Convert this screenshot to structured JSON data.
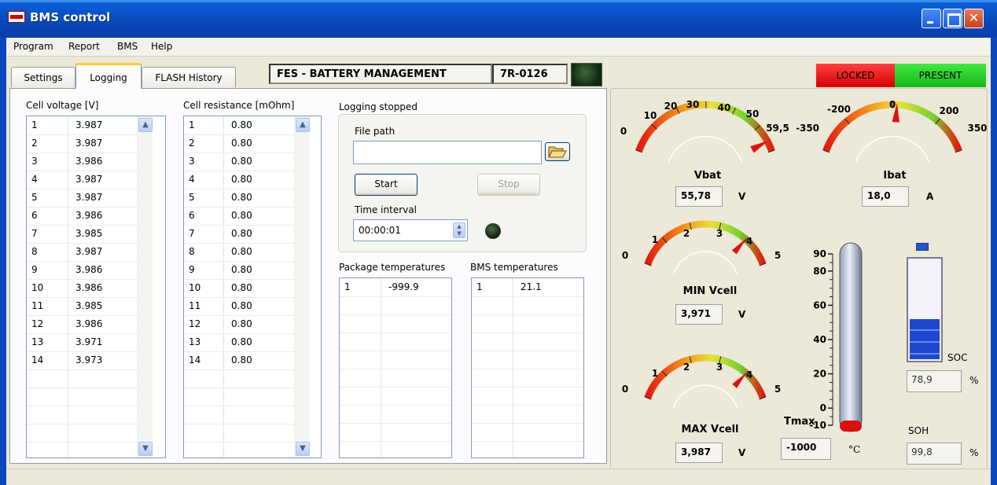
{
  "window": {
    "title": "BMS control"
  },
  "menu": [
    "Program",
    "Report",
    "BMS",
    "Help"
  ],
  "tabs": [
    "Settings",
    "Logging",
    "FLASH History"
  ],
  "header": {
    "device_name": "FES - BATTERY MANAGEMENT",
    "device_id": "7R-0126"
  },
  "status": {
    "locked": "LOCKED",
    "present": "PRESENT",
    "locked_color": "#e81c1c",
    "present_color": "#2ad12a"
  },
  "cell_voltage": {
    "label": "Cell voltage [V]",
    "rows": [
      [
        "1",
        "3.987"
      ],
      [
        "2",
        "3.987"
      ],
      [
        "3",
        "3.986"
      ],
      [
        "4",
        "3.987"
      ],
      [
        "5",
        "3.987"
      ],
      [
        "6",
        "3.986"
      ],
      [
        "7",
        "3.985"
      ],
      [
        "8",
        "3.987"
      ],
      [
        "9",
        "3.986"
      ],
      [
        "10",
        "3.986"
      ],
      [
        "11",
        "3.985"
      ],
      [
        "12",
        "3.986"
      ],
      [
        "13",
        "3.971"
      ],
      [
        "14",
        "3.973"
      ]
    ]
  },
  "cell_resistance": {
    "label": "Cell resistance [mOhm]",
    "rows": [
      [
        "1",
        "0.80"
      ],
      [
        "2",
        "0.80"
      ],
      [
        "3",
        "0.80"
      ],
      [
        "4",
        "0.80"
      ],
      [
        "5",
        "0.80"
      ],
      [
        "6",
        "0.80"
      ],
      [
        "7",
        "0.80"
      ],
      [
        "8",
        "0.80"
      ],
      [
        "9",
        "0.80"
      ],
      [
        "10",
        "0.80"
      ],
      [
        "11",
        "0.80"
      ],
      [
        "12",
        "0.80"
      ],
      [
        "13",
        "0.80"
      ],
      [
        "14",
        "0.80"
      ]
    ]
  },
  "logging": {
    "status": "Logging stopped",
    "file_path_label": "File path",
    "file_path_value": "",
    "start_label": "Start",
    "stop_label": "Stop",
    "time_interval_label": "Time interval",
    "time_interval_value": "00:00:01"
  },
  "package_temperatures": {
    "label": "Package temperatures",
    "rows": [
      [
        "1",
        "-999.9"
      ]
    ]
  },
  "bms_temperatures": {
    "label": "BMS temperatures",
    "rows": [
      [
        "1",
        "21.1"
      ]
    ]
  },
  "gauges": {
    "vbat": {
      "title": "Vbat",
      "value": "55,78",
      "unit": "V",
      "ticks": [
        "0",
        "10",
        "20",
        "30",
        "40",
        "50",
        "59,5"
      ],
      "min": 0,
      "max": 59.5,
      "reading": 55.78
    },
    "ibat": {
      "title": "Ibat",
      "value": "18,0",
      "unit": "A",
      "ticks": [
        "-350",
        "-200",
        "0",
        "200",
        "350"
      ],
      "min": -350,
      "max": 350,
      "reading": 18.0
    },
    "min_vcell": {
      "title": "MIN Vcell",
      "value": "3,971",
      "unit": "V",
      "ticks": [
        "0",
        "1",
        "2",
        "3",
        "4",
        "5"
      ],
      "min": 0,
      "max": 5,
      "reading": 3.971
    },
    "max_vcell": {
      "title": "MAX Vcell",
      "value": "3,987",
      "unit": "V",
      "ticks": [
        "0",
        "1",
        "2",
        "3",
        "4",
        "5"
      ],
      "min": 0,
      "max": 5,
      "reading": 3.987
    }
  },
  "thermometer": {
    "title": "Tmax",
    "value": "-1000",
    "unit": "°C",
    "ticks": [
      "90",
      "80",
      "60",
      "40",
      "20",
      "0",
      "-10"
    ]
  },
  "soc": {
    "label": "SOC",
    "value": "78,9",
    "unit": "%",
    "level_percent": 78.9
  },
  "soh": {
    "label": "SOH",
    "value": "99,8",
    "unit": "%"
  },
  "icons": {
    "folder": "folder-open-icon",
    "spin": "spin-updown-icon"
  }
}
